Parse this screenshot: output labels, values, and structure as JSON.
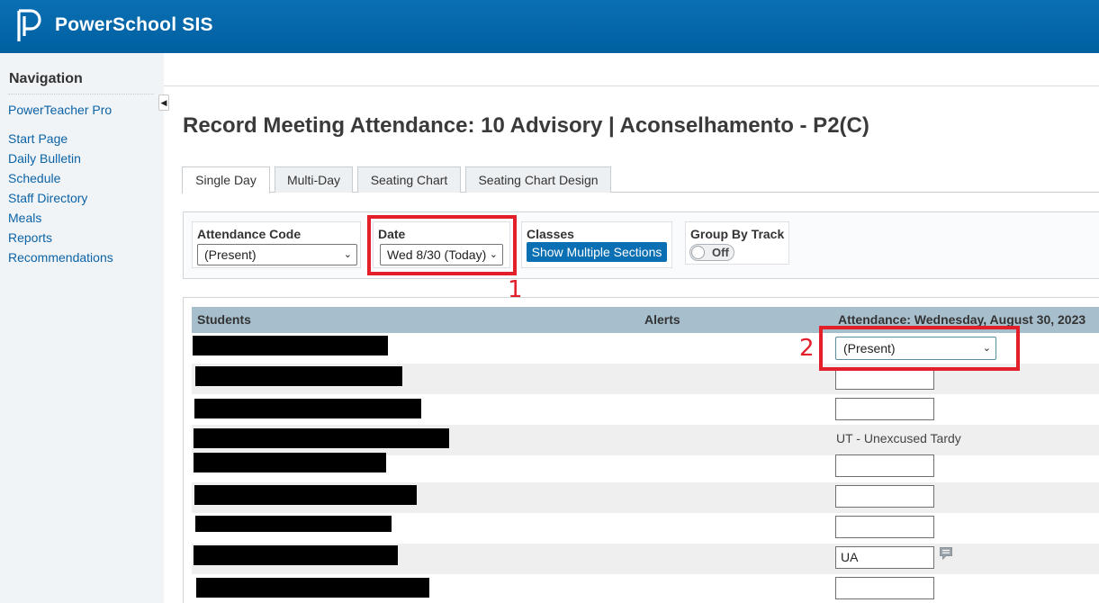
{
  "app": {
    "brand": "PowerSchool SIS"
  },
  "colors": {
    "header": "#0a6fb3",
    "link": "#0b63a6",
    "annotation": "#e3202a",
    "table_header": "#a7bfcd"
  },
  "sidebar": {
    "title": "Navigation",
    "links": [
      {
        "label": "PowerTeacher Pro"
      },
      {
        "label": "Start Page"
      },
      {
        "label": "Daily Bulletin"
      },
      {
        "label": "Schedule"
      },
      {
        "label": "Staff Directory"
      },
      {
        "label": "Meals"
      },
      {
        "label": "Reports"
      },
      {
        "label": "Recommendations"
      }
    ]
  },
  "page": {
    "title": "Record Meeting Attendance: 10 Advisory | Aconselhamento - P2(C)"
  },
  "tabs": [
    {
      "label": "Single Day",
      "active": true
    },
    {
      "label": "Multi-Day",
      "active": false
    },
    {
      "label": "Seating Chart",
      "active": false
    },
    {
      "label": "Seating Chart Design",
      "active": false
    }
  ],
  "controls": {
    "attendance_code": {
      "label": "Attendance Code",
      "value": "(Present)"
    },
    "date": {
      "label": "Date",
      "value": "Wed 8/30 (Today)"
    },
    "classes": {
      "label": "Classes",
      "button": "Show Multiple Sections"
    },
    "group_by_track": {
      "label": "Group By Track",
      "toggle": "Off"
    }
  },
  "annotations": {
    "one": "1",
    "two": "2"
  },
  "table": {
    "headers": {
      "students": "Students",
      "alerts": "Alerts",
      "attendance": "Attendance: Wednesday, August 30, 2023"
    },
    "rows": [
      {
        "attendance": "(Present)",
        "kind": "select"
      },
      {
        "attendance": "",
        "kind": "input"
      },
      {
        "attendance": "",
        "kind": "input"
      },
      {
        "attendance": "UT - Unexcused Tardy",
        "kind": "text"
      },
      {
        "attendance": "",
        "kind": "input"
      },
      {
        "attendance": "",
        "kind": "input"
      },
      {
        "attendance": "",
        "kind": "input"
      },
      {
        "attendance": "UA",
        "kind": "input"
      },
      {
        "attendance": "",
        "kind": "input"
      }
    ]
  }
}
